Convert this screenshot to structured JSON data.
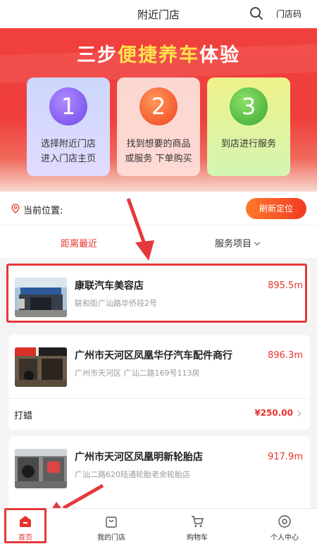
{
  "header": {
    "title": "附近门店",
    "search_icon": "search-icon",
    "store_code_label": "门店码"
  },
  "banner": {
    "headline_pre": "三步",
    "headline_highlight": "便捷养车",
    "headline_post": "体验",
    "steps": [
      {
        "num": "1",
        "line1": "选择附近门店",
        "line2": "进入门店主页"
      },
      {
        "num": "2",
        "line1": "找到想要的商品",
        "line2": "或服务 下单购买"
      },
      {
        "num": "3",
        "line1": "到店进行服务",
        "line2": ""
      }
    ]
  },
  "location": {
    "label": "当前位置:",
    "refresh_label": "刷新定位"
  },
  "sort": {
    "nearest": "距离最近",
    "service": "服务项目"
  },
  "stores": [
    {
      "name": "康联汽车美容店",
      "address": "联和街广汕路华侨段2号",
      "distance": "895.5m"
    },
    {
      "name": "广州市天河区凤凰华仔汽车配件商行",
      "address": "广州市天河区 广汕二路169号113房",
      "distance": "896.3m",
      "service": "打蜡",
      "price": "¥250.00"
    },
    {
      "name": "广州市天河区凤凰明新轮胎店",
      "address": "广汕二路620陆通轮胎老余轮胎店",
      "distance": "917.9m"
    }
  ],
  "tabbar": {
    "items": [
      {
        "label": "首页",
        "icon": "home-icon"
      },
      {
        "label": "我的门店",
        "icon": "store-bag-icon"
      },
      {
        "label": "购物车",
        "icon": "cart-icon"
      },
      {
        "label": "个人中心",
        "icon": "user-icon"
      }
    ]
  },
  "colors": {
    "accent": "#e8332b",
    "banner_red": "#f0403e",
    "highlight_yellow": "#ffe24a"
  }
}
